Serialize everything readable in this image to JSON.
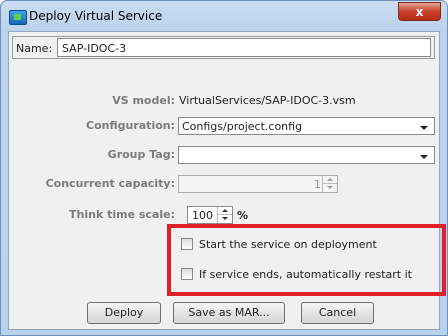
{
  "window": {
    "title": "Deploy Virtual Service",
    "close_label": "x"
  },
  "name_field": {
    "label": "Name:",
    "value": "SAP-IDOC-3"
  },
  "vs_model": {
    "label": "VS model:",
    "value": "VirtualServices/SAP-IDOC-3.vsm"
  },
  "configuration": {
    "label": "Configuration:",
    "value": "Configs/project.config"
  },
  "group_tag": {
    "label": "Group Tag:",
    "value": ""
  },
  "concurrent_capacity": {
    "label": "Concurrent capacity:",
    "value": "1"
  },
  "think_time": {
    "label": "Think time scale:",
    "value": "100",
    "unit": "%"
  },
  "options": {
    "start_on_deploy": {
      "label": "Start the service on deployment",
      "checked": false
    },
    "auto_restart": {
      "label": "If service ends, automatically restart it",
      "checked": false
    }
  },
  "buttons": {
    "deploy": "Deploy",
    "save_mar": "Save as MAR...",
    "cancel": "Cancel"
  },
  "colors": {
    "highlight": "#e4202c",
    "title_bar": "#c9dcf1"
  }
}
